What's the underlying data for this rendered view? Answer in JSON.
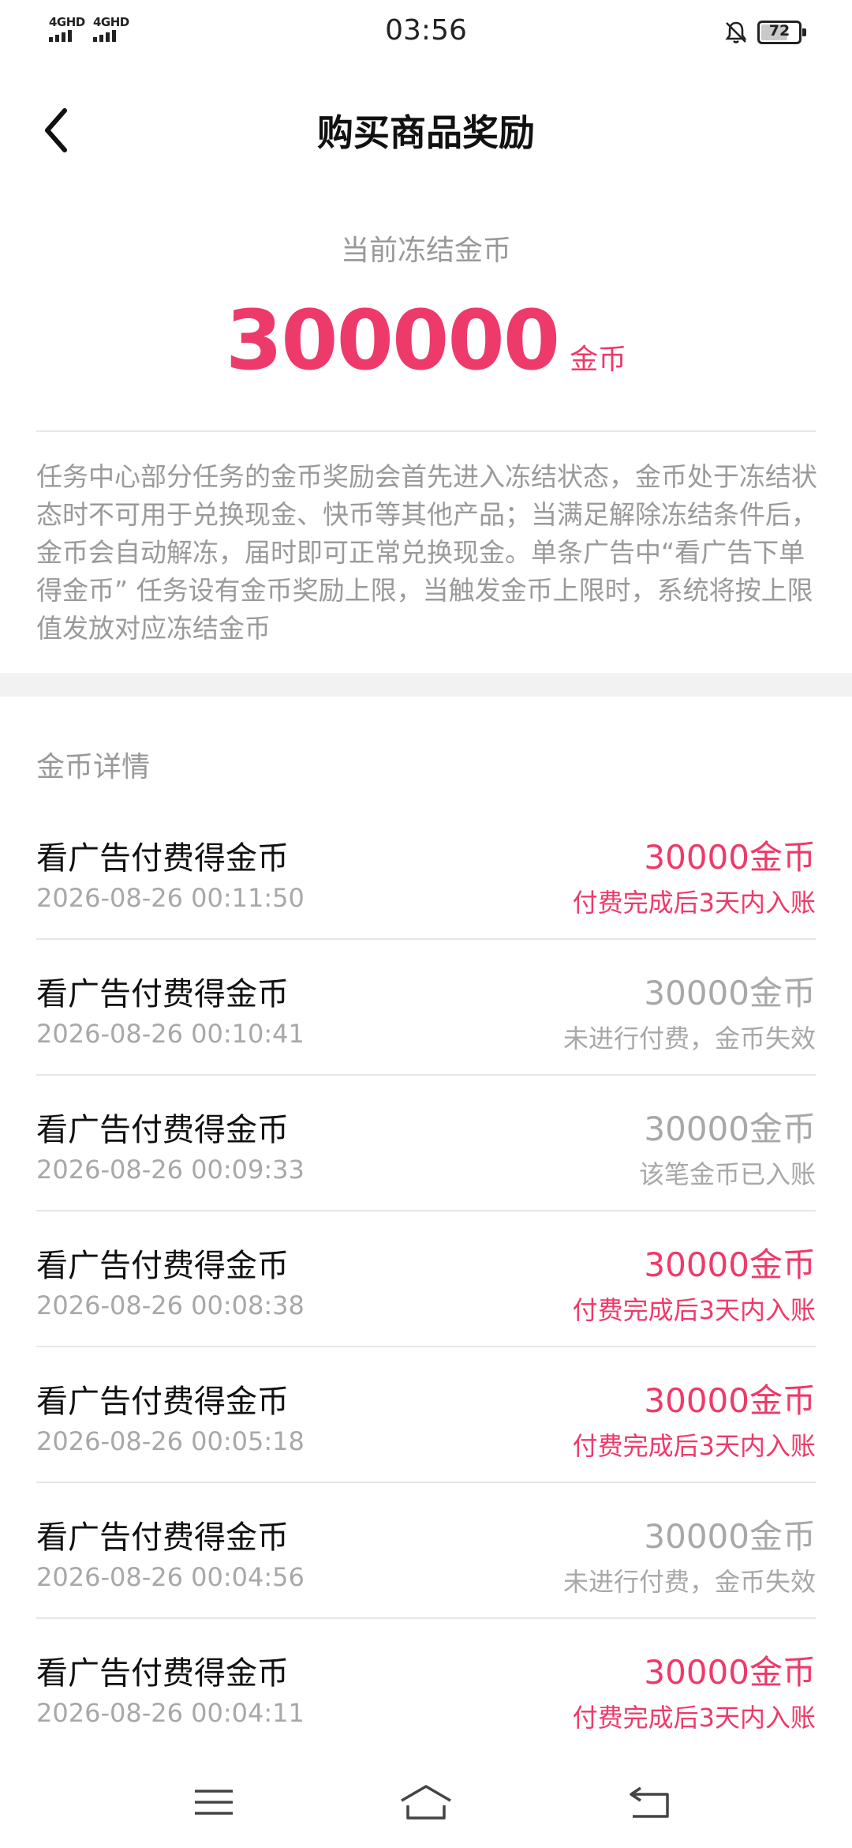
{
  "status_bar": {
    "net1": "4GHD",
    "net2": "4GHD",
    "time": "03:56",
    "battery": "72",
    "battery_level": 0.72
  },
  "nav": {
    "title": "购买商品奖励"
  },
  "summary": {
    "label": "当前冻结金币",
    "amount": "300000",
    "unit": "金币"
  },
  "description": "任务中心部分任务的金币奖励会首先进入冻结状态，金币处于冻结状态时不可用于兑换现金、快币等其他产品；当满足解除冻结条件后，金币会自动解冻，届时即可正常兑换现金。单条广告中“看广告下单得金币” 任务设有金币奖励上限，当触发金币上限时，系统将按上限值发放对应冻结金币",
  "details": {
    "title": "金币详情",
    "items": [
      {
        "title": "看广告付费得金币",
        "time": "2026-08-26 00:11:50",
        "amount": "30000金币",
        "note": "付费完成后3天内入账",
        "status": "pending"
      },
      {
        "title": "看广告付费得金币",
        "time": "2026-08-26 00:10:41",
        "amount": "30000金币",
        "note": "未进行付费，金币失效",
        "status": "invalid"
      },
      {
        "title": "看广告付费得金币",
        "time": "2026-08-26 00:09:33",
        "amount": "30000金币",
        "note": "该笔金币已入账",
        "status": "credited"
      },
      {
        "title": "看广告付费得金币",
        "time": "2026-08-26 00:08:38",
        "amount": "30000金币",
        "note": "付费完成后3天内入账",
        "status": "pending"
      },
      {
        "title": "看广告付费得金币",
        "time": "2026-08-26 00:05:18",
        "amount": "30000金币",
        "note": "付费完成后3天内入账",
        "status": "pending"
      },
      {
        "title": "看广告付费得金币",
        "time": "2026-08-26 00:04:56",
        "amount": "30000金币",
        "note": "未进行付费，金币失效",
        "status": "invalid"
      },
      {
        "title": "看广告付费得金币",
        "time": "2026-08-26 00:04:11",
        "amount": "30000金币",
        "note": "付费完成后3天内入账",
        "status": "pending"
      }
    ]
  },
  "colors": {
    "accent": "#ee3a6a",
    "muted": "#a8a8a8"
  },
  "icons": {
    "back": "chevron-left-icon",
    "menu": "menu-icon",
    "home": "home-icon",
    "return": "return-icon",
    "bell": "bell-off-icon"
  }
}
